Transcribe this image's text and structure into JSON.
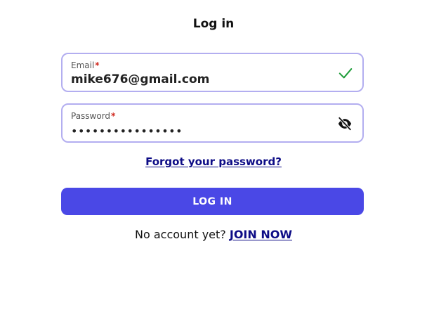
{
  "page": {
    "title": "Log in"
  },
  "email": {
    "label": "Email",
    "required_marker": "*",
    "value": "mike676@gmail.com",
    "status_icon": "check-icon",
    "status_color": "#1f9d3a"
  },
  "password": {
    "label": "Password",
    "required_marker": "*",
    "masked_value": "••••••••••••••••",
    "toggle_icon": "eye-slash-icon"
  },
  "links": {
    "forgot_password": "Forgot your password?"
  },
  "login_button": {
    "label": "LOG IN",
    "color": "#4a48e6"
  },
  "signup": {
    "prompt": "No account yet?",
    "link": "JOIN NOW"
  },
  "colors": {
    "field_border": "#b3aef0",
    "link": "#0d0c86",
    "required": "#d0271d"
  }
}
